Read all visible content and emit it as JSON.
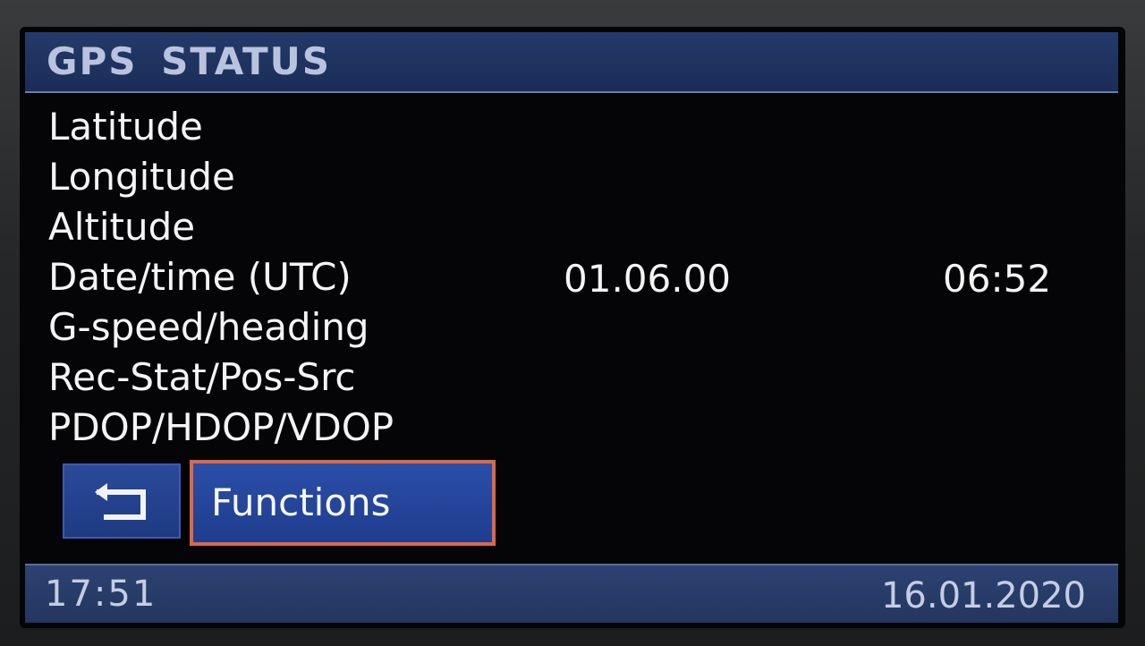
{
  "header": {
    "title": "GPS STATUS"
  },
  "rows": [
    {
      "label": "Latitude",
      "value1": "",
      "value2": ""
    },
    {
      "label": "Longitude",
      "value1": "",
      "value2": ""
    },
    {
      "label": "Altitude",
      "value1": "",
      "value2": ""
    },
    {
      "label": "Date/time (UTC)",
      "value1": "01.06.00",
      "value2": "06:52"
    },
    {
      "label": "G-speed/heading",
      "value1": "",
      "value2": ""
    },
    {
      "label": "Rec-Stat/Pos-Src",
      "value1": "",
      "value2": ""
    },
    {
      "label": "PDOP/HDOP/VDOP",
      "value1": "",
      "value2": ""
    }
  ],
  "buttons": {
    "back_icon": "return-arrow-icon",
    "functions_label": "Functions"
  },
  "footer": {
    "time": "17:51",
    "date": "16.01.2020"
  },
  "colors": {
    "header_bg": "#1a2d58",
    "footer_bg": "#22365f",
    "button_bg": "#1f3d8e",
    "focus_border": "#d86a4c",
    "text": "#f4f4f4"
  }
}
